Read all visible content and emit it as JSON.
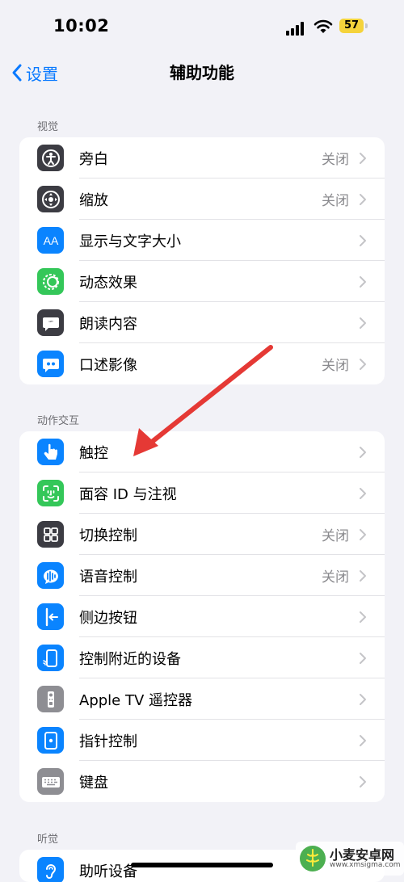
{
  "status": {
    "time": "10:02",
    "battery": "57"
  },
  "nav": {
    "back_label": "设置",
    "title": "辅助功能"
  },
  "sections": {
    "vision": {
      "header": "视觉",
      "rows": [
        {
          "label": "旁白",
          "value": "关闭",
          "icon": "voiceover-icon",
          "color": "#3c3c43"
        },
        {
          "label": "缩放",
          "value": "关闭",
          "icon": "zoom-icon",
          "color": "#3c3c43"
        },
        {
          "label": "显示与文字大小",
          "value": "",
          "icon": "text-size-icon",
          "color": "#0a84ff"
        },
        {
          "label": "动态效果",
          "value": "",
          "icon": "motion-icon",
          "color": "#34c759"
        },
        {
          "label": "朗读内容",
          "value": "",
          "icon": "spoken-content-icon",
          "color": "#3c3c43"
        },
        {
          "label": "口述影像",
          "value": "关闭",
          "icon": "audio-description-icon",
          "color": "#0a84ff"
        }
      ]
    },
    "interaction": {
      "header": "动作交互",
      "rows": [
        {
          "label": "触控",
          "value": "",
          "icon": "touch-icon",
          "color": "#0a84ff"
        },
        {
          "label": "面容 ID 与注视",
          "value": "",
          "icon": "face-id-icon",
          "color": "#34c759"
        },
        {
          "label": "切换控制",
          "value": "关闭",
          "icon": "switch-control-icon",
          "color": "#3c3c43"
        },
        {
          "label": "语音控制",
          "value": "关闭",
          "icon": "voice-control-icon",
          "color": "#0a84ff"
        },
        {
          "label": "侧边按钮",
          "value": "",
          "icon": "side-button-icon",
          "color": "#0a84ff"
        },
        {
          "label": "控制附近的设备",
          "value": "",
          "icon": "nearby-devices-icon",
          "color": "#0a84ff"
        },
        {
          "label": "Apple TV 遥控器",
          "value": "",
          "icon": "apple-tv-remote-icon",
          "color": "#8e8e93"
        },
        {
          "label": "指针控制",
          "value": "",
          "icon": "pointer-control-icon",
          "color": "#0a84ff"
        },
        {
          "label": "键盘",
          "value": "",
          "icon": "keyboard-icon",
          "color": "#8e8e93"
        }
      ]
    },
    "hearing": {
      "header": "听觉",
      "rows": [
        {
          "label": "助听设备",
          "value": "",
          "icon": "hearing-devices-icon",
          "color": "#0a84ff"
        }
      ]
    }
  },
  "watermark": {
    "title": "小麦安卓网",
    "url": "www.xmsigma.com"
  }
}
